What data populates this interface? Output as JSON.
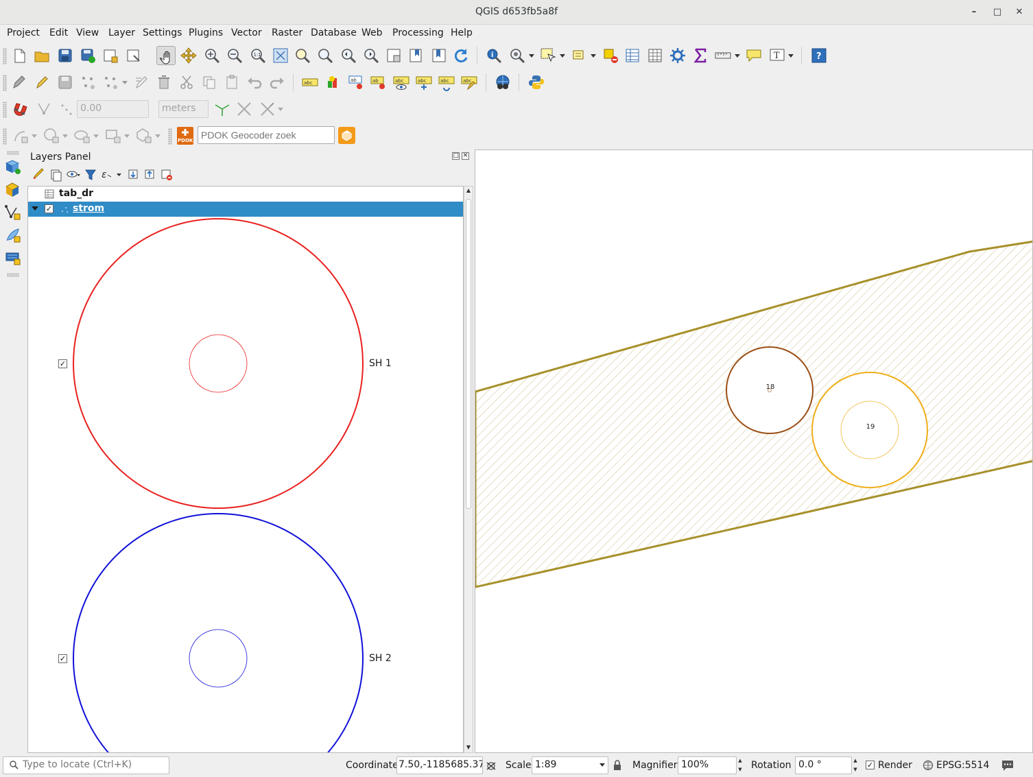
{
  "window": {
    "title": "QGIS d653fb5a8f"
  },
  "menu": [
    "Project",
    "Edit",
    "View",
    "Layer",
    "Settings",
    "Plugins",
    "Vector",
    "Raster",
    "Database",
    "Web",
    "Processing",
    "Help"
  ],
  "snapping": {
    "tolerance": "0.00",
    "units": "meters"
  },
  "geocoder": {
    "placeholder": "PDOK Geocoder zoek",
    "badge": "PDOK"
  },
  "layers_panel": {
    "title": "Layers Panel",
    "layers": [
      {
        "name": "tab_dr",
        "type": "table"
      },
      {
        "name": "strom",
        "type": "point",
        "checked": true
      }
    ],
    "legend": [
      {
        "label": "SH 1",
        "color": "#e8201e",
        "checked": true
      },
      {
        "label": "SH 2",
        "color": "#1010d8",
        "checked": true
      }
    ]
  },
  "map": {
    "points": [
      {
        "label": "18",
        "color": "#9a4c12"
      },
      {
        "label": "19",
        "color": "#efae1a"
      }
    ],
    "polygon_color": "#a7902a"
  },
  "statusbar": {
    "locate_placeholder": "Type to locate (Ctrl+K)",
    "coordinate_label": "Coordinate",
    "coordinate": "7.50,-1185685.37",
    "scale_label": "Scale",
    "scale": "1:89",
    "magnifier_label": "Magnifier",
    "magnifier": "100%",
    "rotation_label": "Rotation",
    "rotation": "0.0 °",
    "render_label": "Render",
    "crs": "EPSG:5514"
  }
}
